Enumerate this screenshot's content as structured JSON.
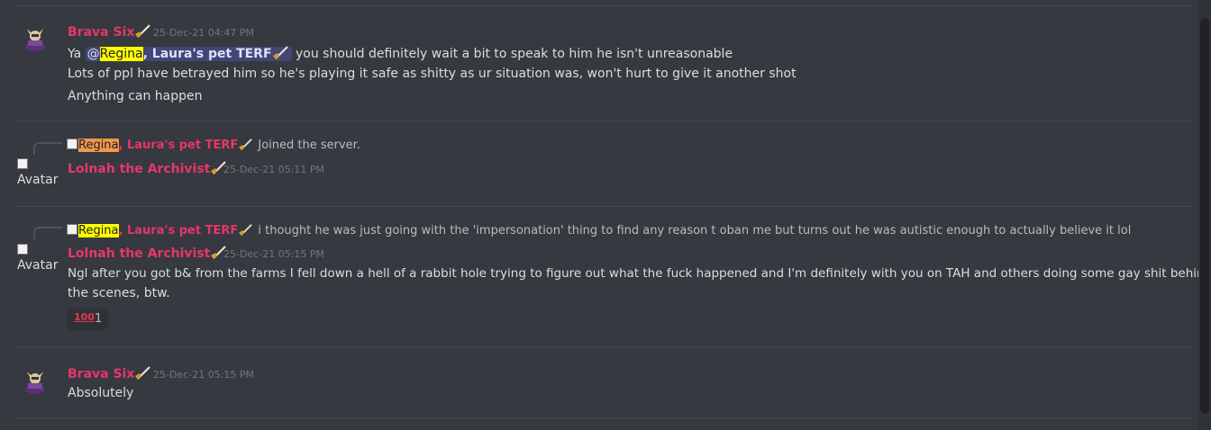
{
  "colors": {
    "background": "#36393f",
    "author": "#e5376a",
    "text": "#dcddde",
    "timestamp": "#72767d",
    "mention_bg": "#414675",
    "highlight_yellow": "#ffff00",
    "highlight_orange": "#f0974d"
  },
  "messages": [
    {
      "author": "Brava Six",
      "timestamp": "25-Dec-21 04:47 PM",
      "line1_prefix": "Ya ",
      "mention_at": "@",
      "mention_highlight": "Regina",
      "mention_rest": ", Laura's pet TERF",
      "line1_suffix": "  you should definitely wait a bit to speak to him he isn't unreasonable",
      "line2": "Lots of ppl have betrayed him so he's playing it safe as shitty as ur situation was, won't hurt to give it another shot",
      "line3": "Anything can happen"
    },
    {
      "reply_highlight": "Regina",
      "reply_name": ", Laura's pet TERF",
      "reply_text": " Joined the server.",
      "avatar_alt": "Avatar",
      "author": "Lolnah the Archivist",
      "timestamp": "25-Dec-21 05:11 PM"
    },
    {
      "reply_highlight": "Regina",
      "reply_name": ", Laura's pet TERF",
      "reply_text": " i thought he was just going with the 'impersonation' thing to find any reason t oban me but turns out he was autistic enough to actually believe it lol",
      "avatar_alt": "Avatar",
      "author": "Lolnah the Archivist",
      "timestamp": "25-Dec-21 05:15 PM",
      "line1": "Ngl after you got b& from the farms I fell down a hell of a rabbit hole trying to figure out what the fuck happened and I'm definitely with you on TAH and others doing some gay shit behind",
      "line2": "the scenes, btw.",
      "reaction_emoji": "100",
      "reaction_count": "1"
    },
    {
      "author": "Brava Six",
      "timestamp": "25-Dec-21 05:15 PM",
      "line1": "Absolutely"
    }
  ]
}
